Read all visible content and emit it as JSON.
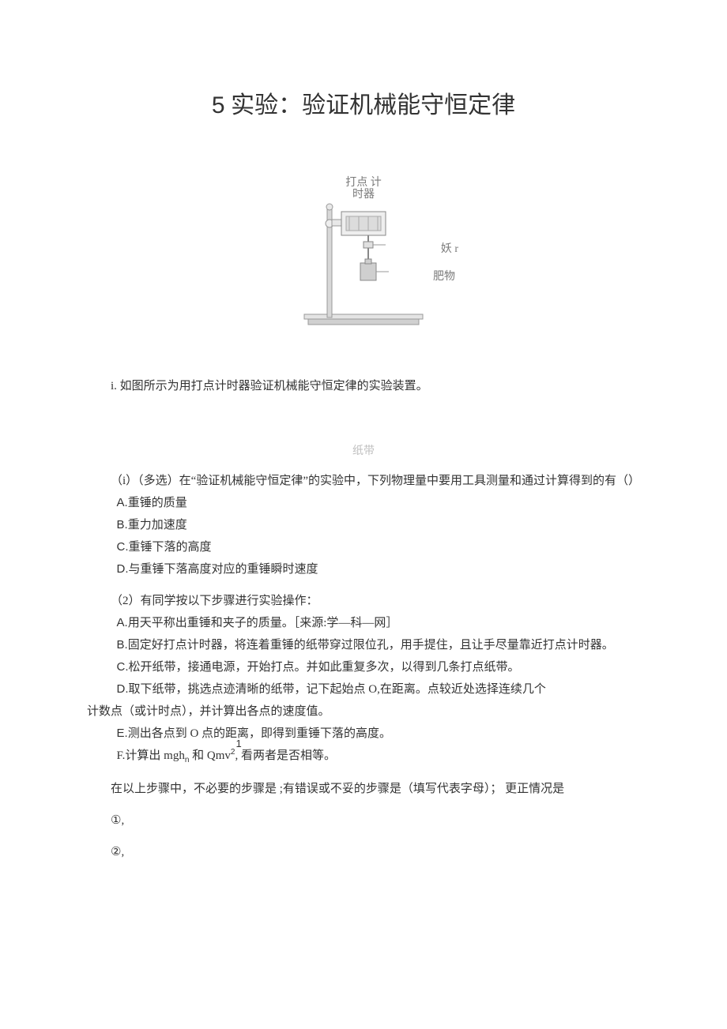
{
  "title": {
    "num": "5",
    "text": "实验：验证机械能守恒定律"
  },
  "figure": {
    "label_top_l1": "打点 计",
    "label_top_l2": "时器",
    "label_clip": "妖 r",
    "label_mass": "肥物"
  },
  "intro": "i. 如图所示为用打点计时器验证机械能守恒定律的实验装置。",
  "caption_tape": "纸带",
  "q1_stem": "（i）（多选）在“验证机械能守恒定律”的实验中，下列物理量中要用工具测量和通过计算得到的有（）",
  "q1_opts": {
    "A": "重锤的质量",
    "B": "重力加速度",
    "C": "重锤下落的高度",
    "D": "与重锤下落高度对应的重锤瞬时速度"
  },
  "q2_stem": "（2）有同学按以下步骤进行实验操作：",
  "q2_opts": {
    "A": "用天平称出重锤和夹子的质量。［来源:学—科—网］",
    "B": "固定好打点计时器，将连着重锤的纸带穿过限位孔，用手提住，且让手尽量靠近打点计时器。",
    "C": "松开纸带，接通电源，开始打点。并如此重复多次，以得到几条打点纸带。",
    "D": "取下纸带，挑选点迹清晰的纸带，记下起始点 O,在距离。点较近处选择连续几个",
    "D_tail": "计数点（或计时点），并计算出各点的速度值。",
    "E": "测出各点到 O 点的距离，即得到重锤下落的高度。",
    "F_pre": "计算出 mgh",
    "F_sub1": "n",
    "F_mid": " 和 Qmv",
    "F_sup": "2",
    "F_end": ", 看两者是否相等。",
    "F_one": "1"
  },
  "tail": "在以上步骤中，不必要的步骤是 ;有错误或不妥的步骤是（填写代表字母）； 更正情况是",
  "blank1": "①,",
  "blank2": "②,"
}
